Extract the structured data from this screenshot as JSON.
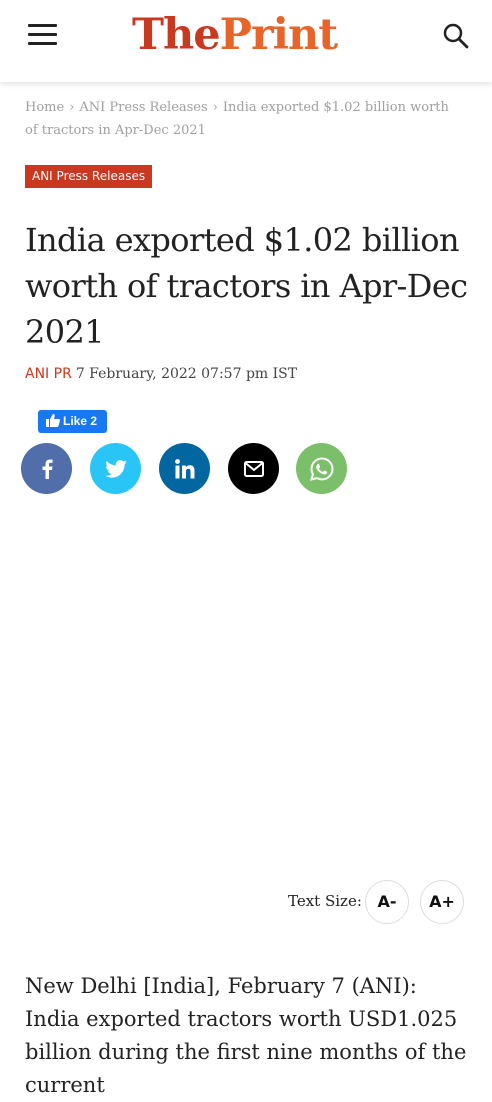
{
  "header": {
    "logo_the": "The",
    "logo_print": "Print",
    "menu_icon": "hamburger-icon",
    "search_icon": "search-icon"
  },
  "breadcrumb": {
    "items": [
      "Home",
      "ANI Press Releases",
      "India exported $1.02 billion worth of tractors in Apr-Dec 2021"
    ],
    "separator": "›"
  },
  "article": {
    "category": "ANI Press Releases",
    "title": "India exported $1.02 billion worth of tractors in Apr-Dec 2021",
    "author": "ANI PR",
    "date": "7 February, 2022 07:57 pm IST",
    "body_start": "New Delhi [India], February 7 (ANI): India exported tractors worth USD1.025 billion during the first nine months of the current"
  },
  "facebook_like": {
    "label": "Like",
    "count": "2"
  },
  "share_buttons": [
    {
      "name": "facebook",
      "icon": "facebook-icon",
      "color": "#516eab"
    },
    {
      "name": "twitter",
      "icon": "twitter-icon",
      "color": "#29c5f6"
    },
    {
      "name": "linkedin",
      "icon": "linkedin-icon",
      "color": "#0266a0"
    },
    {
      "name": "email",
      "icon": "email-icon",
      "color": "#000000"
    },
    {
      "name": "whatsapp",
      "icon": "whatsapp-icon",
      "color": "#7bbf6a"
    }
  ],
  "text_size": {
    "label": "Text Size:",
    "decrease": "A-",
    "increase": "A+"
  },
  "colors": {
    "brand_red": "#c8391f",
    "brand_orange": "#e8652a"
  }
}
